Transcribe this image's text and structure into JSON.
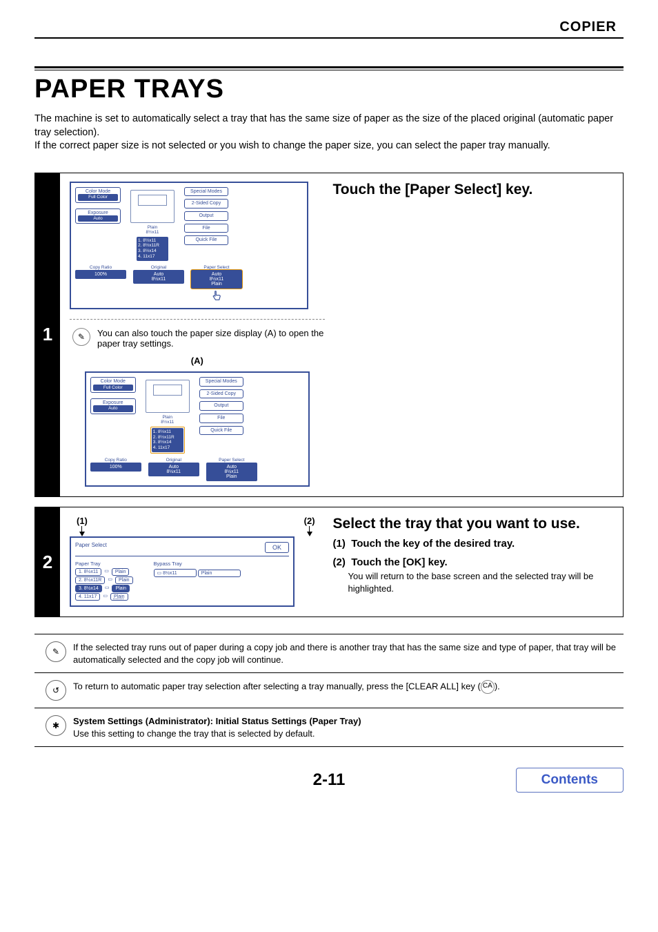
{
  "header": {
    "section": "COPIER"
  },
  "title": "PAPER TRAYS",
  "intro": [
    "The machine is set to automatically select a tray that has the same size of paper as the size of the placed original (automatic paper tray selection).",
    "If the correct paper size is not selected or you wish to change the paper size, you can select the paper tray manually."
  ],
  "step1": {
    "num": "1",
    "heading": "Touch the [Paper Select] key.",
    "hint": "You can also touch the paper size display (A) to open the paper tray settings.",
    "callout": "(A)"
  },
  "step2": {
    "num": "2",
    "heading": "Select the tray that you want to use.",
    "items": [
      {
        "num": "(1)",
        "label": "Touch the key of the desired tray."
      },
      {
        "num": "(2)",
        "label": "Touch the [OK] key."
      }
    ],
    "sub": "You will return to the base screen and the selected tray will be highlighted.",
    "paren1": "(1)",
    "paren2": "(2)"
  },
  "panel": {
    "left": {
      "colorMode": "Color Mode",
      "fullColor": "Full Color",
      "exposure": "Exposure",
      "auto": "Auto"
    },
    "mid": {
      "plain": "Plain",
      "size": "8½x11",
      "trays": [
        "1. 8½x11",
        "2. 8½x11R",
        "3. 8½x14",
        "4. 11x17"
      ]
    },
    "right": {
      "special": "Special Modes",
      "twosided": "2-Sided Copy",
      "output": "Output",
      "file": "File",
      "quickfile": "Quick File"
    },
    "bottom": {
      "copyRatio": "Copy Ratio",
      "ratio": "100%",
      "original": "Original",
      "originalAuto": "Auto",
      "originalSize": "8½x11",
      "paperSelect": "Paper Select",
      "psAuto": "Auto",
      "psSize": "8½x11",
      "psPlain": "Plain"
    }
  },
  "selectPanel": {
    "title": "Paper Select",
    "ok": "OK",
    "paperTray": "Paper Tray",
    "bypassTray": "Bypass Tray",
    "bypassSize": "8½x11",
    "bypassType": "Plain",
    "trays": [
      {
        "label": "1. 8½x11",
        "type": "Plain"
      },
      {
        "label": "2. 8½x11R",
        "type": "Plain"
      },
      {
        "label": "3. 8½x14",
        "type": "Plain"
      },
      {
        "label": "4. 11x17",
        "type": "Plain"
      }
    ]
  },
  "notes": {
    "pencil": "If the selected tray runs out of paper during a copy job and there is another tray that has the same size and type of paper, that tray will be automatically selected and the copy job will continue.",
    "back_before": "To return to automatic paper tray selection after selecting a tray manually, press the [CLEAR ALL] key (",
    "back_after": ").",
    "ca": "CA",
    "gear_title": "System Settings (Administrator): Initial Status Settings (Paper Tray)",
    "gear_body": "Use this setting to change the tray that is selected by default."
  },
  "footer": {
    "page": "2-11",
    "contents": "Contents"
  }
}
